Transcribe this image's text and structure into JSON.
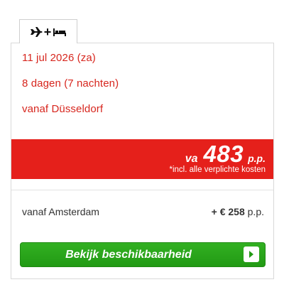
{
  "tab": {
    "icons": [
      "airplane-icon",
      "bed-icon"
    ],
    "plus": "+"
  },
  "trip": {
    "date": "11 jul 2026 (za)",
    "duration": "8 dagen (7 nachten)",
    "departure": "vanaf Düsseldorf"
  },
  "price": {
    "prefix": "va",
    "amount": "483",
    "unit": "p.p.",
    "note": "*incl. alle verplichte kosten"
  },
  "alternative": {
    "label": "vanaf Amsterdam",
    "amount": "+ € 258",
    "unit": "p.p."
  },
  "cta": {
    "label": "Bekijk beschikbaarheid",
    "icon": "chevron-right-icon"
  },
  "colors": {
    "accent_red": "#e5201b",
    "text_red": "#d7261e",
    "button_green": "#229a14"
  }
}
